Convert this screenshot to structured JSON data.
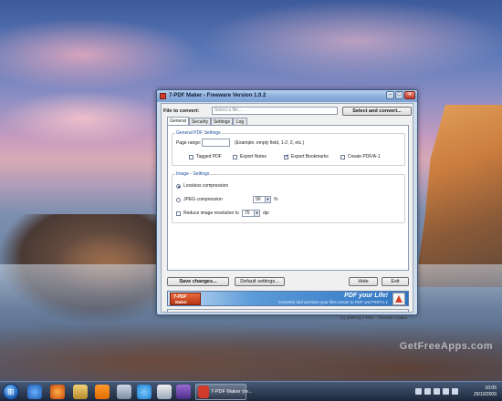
{
  "window": {
    "title": "7-PDF Maker - Freeware Version 1.0.2",
    "minimize": "–",
    "maximize": "□",
    "close": "✕"
  },
  "file": {
    "label": "File to convert:",
    "placeholder": "Select a file...",
    "select_button": "Select and convert..."
  },
  "tabs": [
    "General",
    "Security",
    "Settings",
    "Log"
  ],
  "general_pdf": {
    "title": "General PDF Settings",
    "page_range_label": "Page range:",
    "page_range_value": "",
    "page_range_hint": "(Example: empty field, 1-2, 2, etc.)",
    "checkboxes": [
      {
        "label": "Tagged PDF",
        "checked": false
      },
      {
        "label": "Export Notes",
        "checked": false
      },
      {
        "label": "Export Bookmarks",
        "checked": true
      },
      {
        "label": "Create PDF/A-1",
        "checked": false
      }
    ]
  },
  "image_settings": {
    "title": "Image - Settings",
    "lossless_label": "Lossless compression",
    "lossless_selected": true,
    "jpeg_label": "JPEG compression",
    "jpeg_selected": false,
    "jpeg_value": "90",
    "jpeg_unit": "%",
    "reduce_label": "Reduce image resolution to",
    "reduce_checked": false,
    "reduce_value": "75",
    "reduce_unit": "dpi"
  },
  "buttons": {
    "save": "Save changes...",
    "defaults": "Default settings...",
    "hide": "Hide",
    "exit": "Exit"
  },
  "banner": {
    "logo_line1": "7-PDF",
    "logo_line2": "Maker",
    "tagline": "PDF your Life!",
    "subline": "Converts and archives your files easier to PDF and PDF/A-1"
  },
  "copyright": "(c) 2009 by 7-PDF - Thorsten Hodes",
  "taskbar": {
    "start_icon": "windows-orb-icon",
    "active_item": "7-PDF Maker (re...",
    "time": "10:05",
    "date": "29/10/2009"
  },
  "desktop_watermark": "GetFreeApps.com"
}
